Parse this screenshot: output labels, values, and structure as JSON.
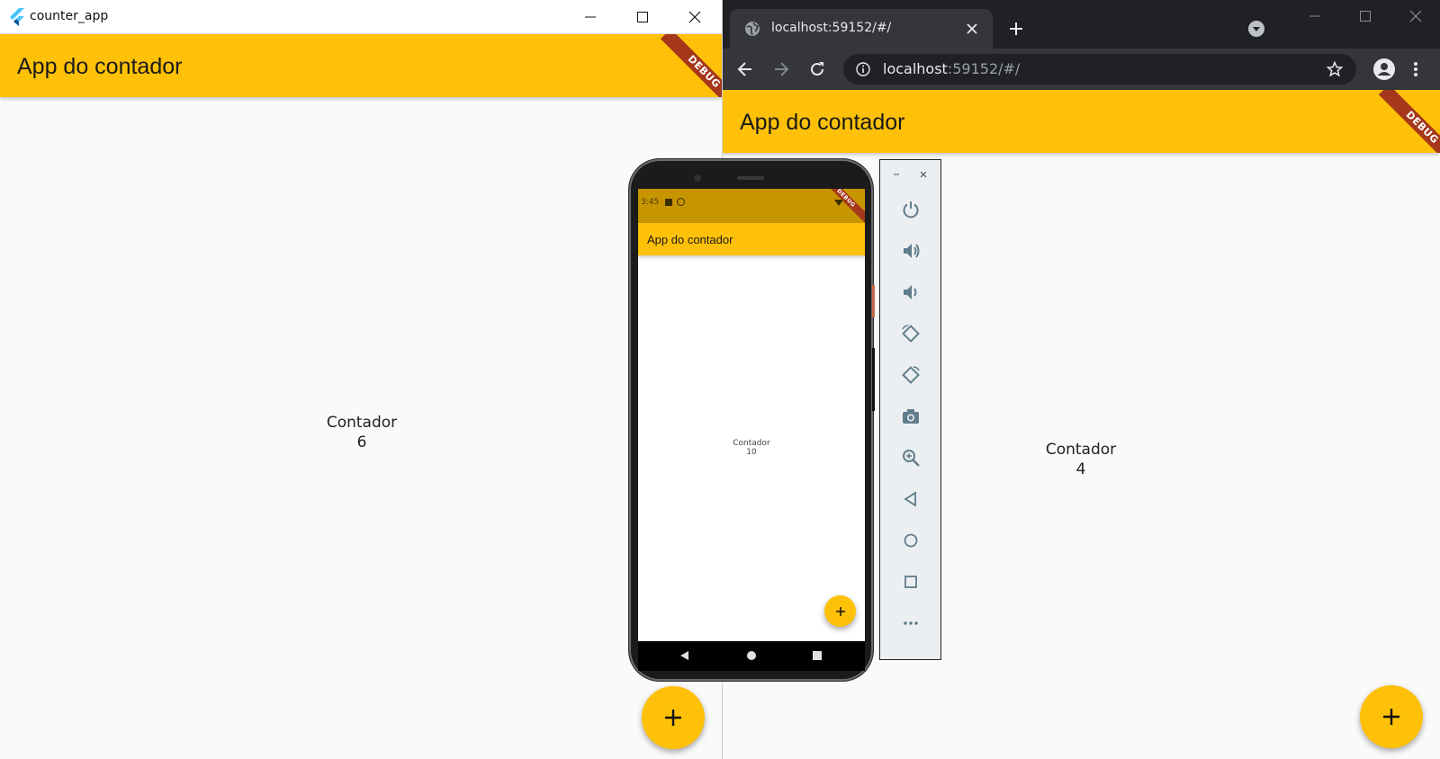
{
  "left_window": {
    "title": "counter_app",
    "appbar_title": "App do contador",
    "debug_label": "DEBUG",
    "counter_label": "Contador",
    "counter_value": "6",
    "fab_icon": "add-icon"
  },
  "browser": {
    "tab_title": "localhost:59152/#/",
    "url_host": "localhost",
    "url_rest": ":59152/#/",
    "appbar_title": "App do contador",
    "debug_label": "DEBUG",
    "counter_label": "Contador",
    "counter_value": "4",
    "fab_icon": "add-icon"
  },
  "emulator": {
    "status_time": "3:45",
    "appbar_title": "App do contador",
    "debug_label": "DEBUG",
    "counter_label": "Contador",
    "counter_value": "10",
    "fab_icon": "add-icon",
    "panel_buttons": [
      "power-icon",
      "volume-up-icon",
      "volume-down-icon",
      "rotate-left-icon",
      "rotate-right-icon",
      "camera-icon",
      "zoom-icon",
      "back-icon",
      "home-icon",
      "overview-icon",
      "more-icon"
    ]
  },
  "colors": {
    "amber": "#ffc107",
    "status_amber": "#c79500",
    "debug_ribbon": "#a5371a",
    "chrome_dark": "#202124",
    "chrome_toolbar": "#35363a"
  }
}
